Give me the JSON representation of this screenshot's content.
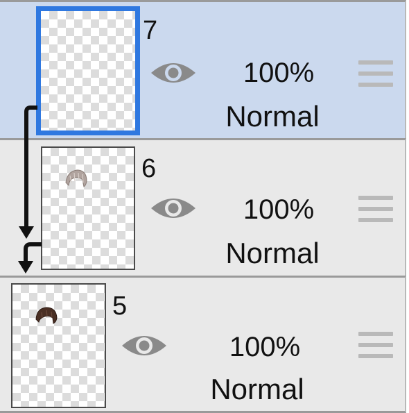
{
  "layers": [
    {
      "number": "7",
      "opacity": "100%",
      "blend_mode": "Normal",
      "selected": true,
      "clipped": true,
      "thumbnail_content": "empty"
    },
    {
      "number": "6",
      "opacity": "100%",
      "blend_mode": "Normal",
      "selected": false,
      "clipped": true,
      "thumbnail_content": "light-hair"
    },
    {
      "number": "5",
      "opacity": "100%",
      "blend_mode": "Normal",
      "selected": false,
      "clipped": false,
      "thumbnail_content": "dark-hair"
    }
  ],
  "colors": {
    "selected_row": "#cbd9ee",
    "row": "#e9e9e9",
    "selected_thumb_border": "#2f78e0",
    "eye_icon": "#8a8a8a"
  },
  "icons": {
    "visibility": "eye-icon",
    "reorder": "drag-handle-icon",
    "clipping": "clip-arrow-icon"
  }
}
